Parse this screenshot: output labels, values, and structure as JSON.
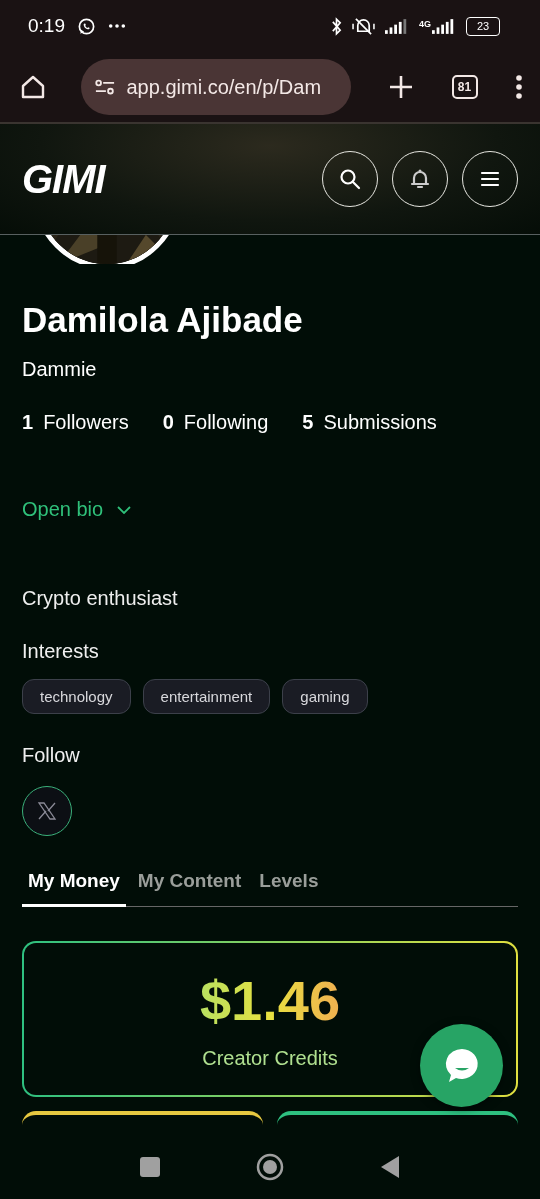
{
  "status_bar": {
    "time": "0:19",
    "network": "4G",
    "battery": "23"
  },
  "browser": {
    "url": "app.gimi.co/en/p/Dam",
    "tab_count": "81"
  },
  "header": {
    "logo": "GIMI"
  },
  "profile": {
    "name": "Damilola Ajibade",
    "username": "Dammie",
    "stats": [
      {
        "count": "1",
        "label": "Followers"
      },
      {
        "count": "0",
        "label": "Following"
      },
      {
        "count": "5",
        "label": "Submissions"
      }
    ],
    "bio_toggle": {
      "label": "Open bio",
      "expanded": false
    },
    "bio": "Crypto enthusiast",
    "interests_title": "Interests",
    "interests": [
      "technology",
      "entertainment",
      "gaming"
    ],
    "follow_title": "Follow"
  },
  "tabs": [
    {
      "label": "My Money",
      "selected": true
    },
    {
      "label": "My Content",
      "selected": false
    },
    {
      "label": "Levels",
      "selected": false
    }
  ],
  "money": {
    "amount": "$1.46",
    "caption": "Creator Credits"
  }
}
